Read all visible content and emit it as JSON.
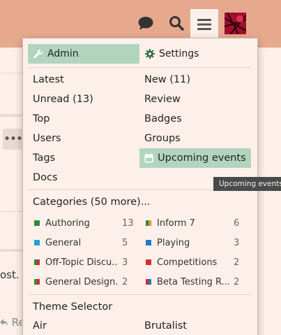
{
  "header": {
    "icons": [
      "chat-icon",
      "search-icon",
      "hamburger-menu-icon"
    ],
    "accent": "#e7a98e"
  },
  "background": {
    "text_fragment": "ost.",
    "reply_fragment": "Re"
  },
  "menu": {
    "tabs": [
      {
        "label": "Admin",
        "icon": "wrench-icon",
        "active": true
      },
      {
        "label": "Settings",
        "icon": "gear-icon",
        "active": false
      }
    ],
    "links_left": [
      "Latest",
      "Unread (13)",
      "Top",
      "Users",
      "Tags",
      "Docs"
    ],
    "links_right": [
      "New (11)",
      "Review",
      "Badges",
      "Groups",
      "Upcoming events"
    ],
    "categories_heading": "Categories (50 more)...",
    "categories_left": [
      {
        "name": "Authoring",
        "count": "13",
        "colors": [
          "#2e8b3c"
        ]
      },
      {
        "name": "General",
        "count": "5",
        "colors": [
          "#1fa3d8"
        ]
      },
      {
        "name": "Off-Topic Discu...",
        "count": "3",
        "colors": [
          "#2e8b3c",
          "#d62b2b"
        ]
      },
      {
        "name": "General Design...",
        "count": "2",
        "colors": [
          "#2e8b3c",
          "#d62b2b"
        ]
      }
    ],
    "categories_right": [
      {
        "name": "Inform 7",
        "count": "6",
        "colors": [
          "#2e8b3c",
          "#e8931c"
        ]
      },
      {
        "name": "Playing",
        "count": "3",
        "colors": [
          "#1f7ac2"
        ]
      },
      {
        "name": "Competitions",
        "count": "2",
        "colors": [
          "#d62b2b"
        ]
      },
      {
        "name": "Beta Testing R...",
        "count": "2",
        "colors": [
          "#d62b2b",
          "#1f7ac2"
        ]
      }
    ],
    "theme_heading": "Theme Selector",
    "themes": [
      "Air",
      "Brutalist"
    ],
    "highlight_color": "#b2d4bf"
  },
  "tooltip": "Upcoming events"
}
